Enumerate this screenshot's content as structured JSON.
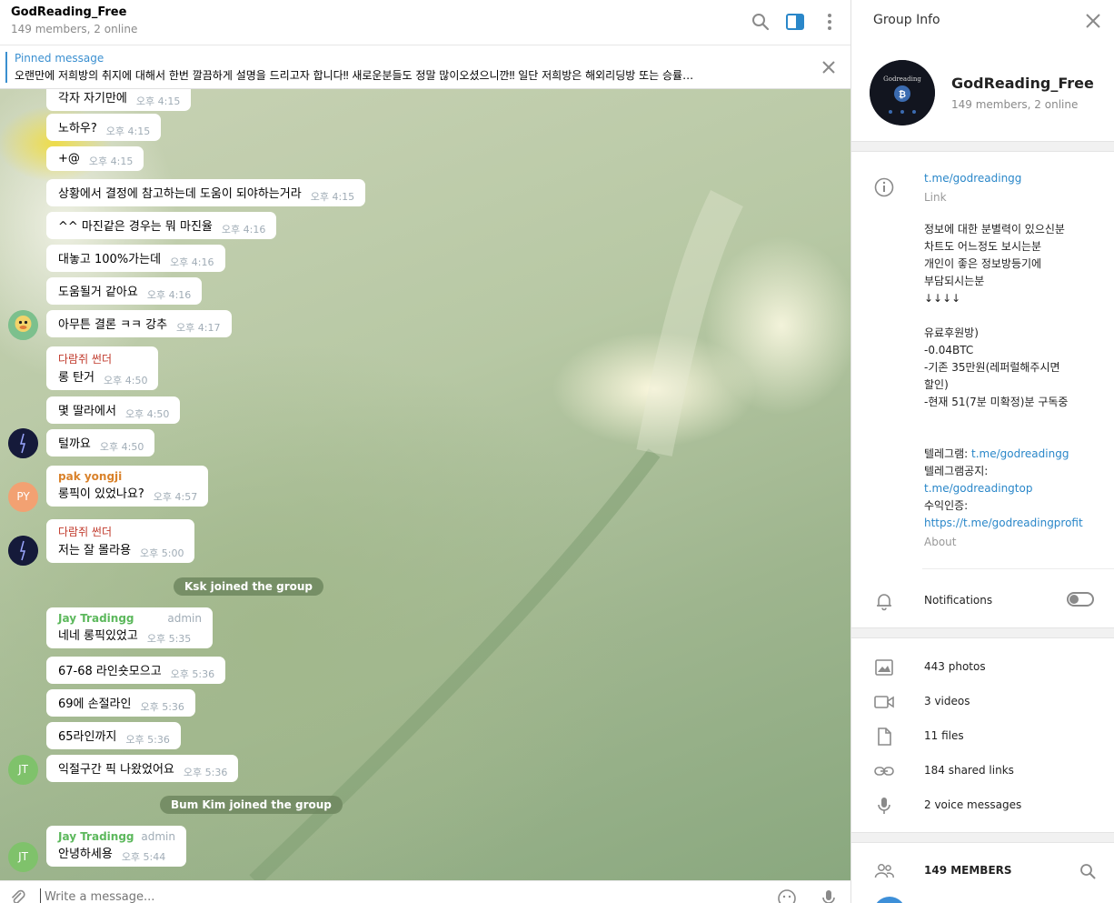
{
  "chat": {
    "title": "GodReading_Free",
    "subtitle": "149 members, 2 online",
    "header_icons": [
      "search-icon",
      "sidebar-toggle-icon",
      "more-vertical-icon"
    ],
    "pinned": {
      "label": "Pinned message",
      "text": "오랜만에 저희방의 취지에 대해서 한번 깔끔하게 설명을 드리고자 합니다‼ 새로운분들도 정말 많이오셨으니깐‼ 일단 저희방은 해외리딩방 또는 승률…"
    },
    "messages": [
      {
        "text": "각자 자기만에",
        "time": "오후 4:15"
      },
      {
        "text": "노하우?",
        "time": "오후 4:15"
      },
      {
        "text": "+@",
        "time": "오후 4:15"
      },
      {
        "text": "상황에서 결정에 참고하는데 도움이 되야하는거라",
        "time": "오후 4:15"
      },
      {
        "text": "^^ 마진같은 경우는 뭐 마진율",
        "time": "오후 4:16"
      },
      {
        "text": "대놓고 100%가는데",
        "time": "오후 4:16"
      },
      {
        "text": "도움될거 같아요",
        "time": "오후 4:16"
      },
      {
        "text": "아무튼 결론 ㅋㅋ 강추",
        "time": "오후 4:17"
      },
      {
        "sender": "다람쥐 썬더",
        "text": "롱 탄거",
        "time": "오후 4:50"
      },
      {
        "text": "몇 딸라에서",
        "time": "오후 4:50"
      },
      {
        "text": "털까요",
        "time": "오후 4:50"
      },
      {
        "sender": "pak yongji",
        "text": "롱픽이 있었나요?",
        "time": "오후 4:57"
      },
      {
        "sender": "다람쥐 썬더",
        "text": "저는 잘 몰라용",
        "time": "오후 5:00"
      },
      {
        "sender": "Jay Tradingg",
        "badge": "admin",
        "text": "네네 롱픽있었고",
        "time": "오후 5:35"
      },
      {
        "text": "67-68 라인숏모으고",
        "time": "오후 5:36"
      },
      {
        "text": "69에 손절라인",
        "time": "오후 5:36"
      },
      {
        "text": "65라인까지",
        "time": "오후 5:36"
      },
      {
        "text": "익절구간 픽 나왔었어요",
        "time": "오후 5:36"
      },
      {
        "sender": "Jay Tradingg",
        "badge": "admin",
        "text": "안녕하세용",
        "time": "오후 5:44"
      }
    ],
    "service": [
      "Ksk joined the group",
      "Bum Kim joined the group"
    ],
    "avatars": {
      "py": "PY",
      "jt": "JT"
    },
    "composer": {
      "placeholder": "Write a message..."
    },
    "colors": {
      "sender_red": "#c0392b",
      "sender_orange": "#d9822b",
      "sender_green": "#5cb85c",
      "link": "#2a87c9"
    }
  },
  "info": {
    "title": "Group Info",
    "group_name": "GodReading_Free",
    "group_sub": "149 members, 2 online",
    "group_avatar_brand": "Godreading",
    "link": "t.me/godreadingg",
    "link_label": "Link",
    "about_lines": [
      "정보에 대한 분별력이 있으신분",
      "차트도 어느정도 보시는분",
      "개인이 좋은 정보방등기에",
      "부담되시는분",
      "↓↓↓↓",
      "",
      "유료후원방)",
      "-0.04BTC",
      "-기존 35만원(레퍼럴해주시면",
      "할인)",
      " -현재 51(7분 미확정)분 구독중",
      "",
      ""
    ],
    "telegram_label": "텔레그램: ",
    "telegram_link": "t.me/godreadingg",
    "notice_label": "텔레그램공지:",
    "notice_link": "t.me/godreadingtop",
    "profit_label": "수익인증:",
    "profit_link": "https://t.me/godreadingprofit",
    "about_label": "About",
    "notifications": "Notifications",
    "notifications_on": false,
    "media": [
      {
        "icon": "photo-icon",
        "label": "443 photos"
      },
      {
        "icon": "video-icon",
        "label": "3 videos"
      },
      {
        "icon": "file-icon",
        "label": "11 files"
      },
      {
        "icon": "link-icon",
        "label": "184 shared links"
      },
      {
        "icon": "microphone-icon",
        "label": "2 voice messages"
      }
    ],
    "members_label": "149 MEMBERS"
  }
}
